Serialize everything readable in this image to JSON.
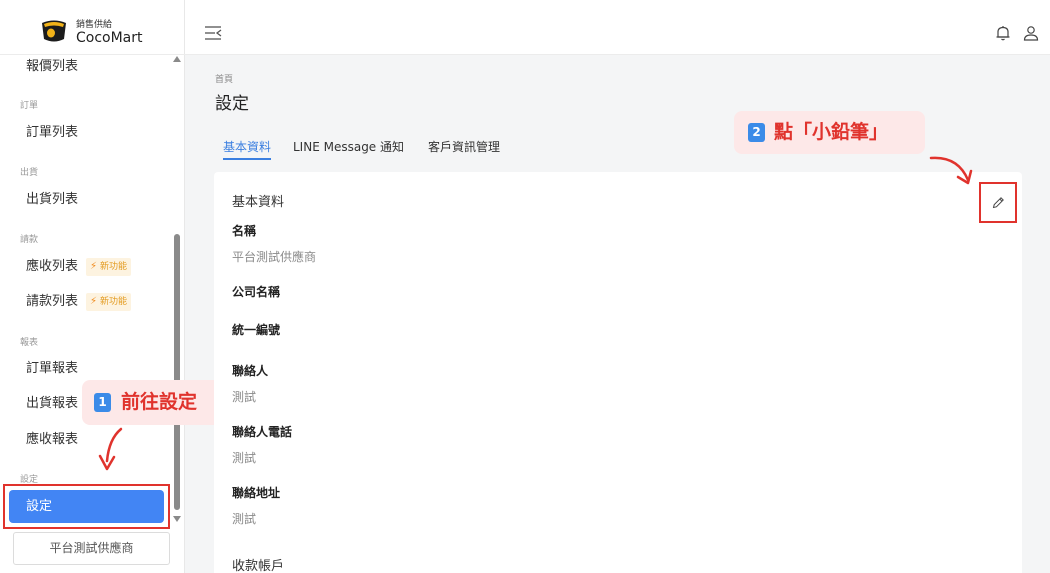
{
  "logo": {
    "subtitle": "銷售供給",
    "name": "CocoMart"
  },
  "sidebar": {
    "items": [
      {
        "label": "報價列表"
      },
      {
        "group": "訂單"
      },
      {
        "label": "訂單列表"
      },
      {
        "group": "出貨"
      },
      {
        "label": "出貨列表"
      },
      {
        "group": "請款"
      },
      {
        "label": "應收列表",
        "badge": "新功能"
      },
      {
        "label": "請款列表",
        "badge": "新功能"
      },
      {
        "group": "報表"
      },
      {
        "label": "訂單報表"
      },
      {
        "label": "出貨報表"
      },
      {
        "label": "應收報表"
      },
      {
        "group": "設定"
      },
      {
        "label": "設定",
        "active": true
      }
    ],
    "badge_icon": "⚡",
    "supplier_button": "平台測試供應商"
  },
  "annotations": {
    "step1": {
      "number": "1",
      "text": "前往設定"
    },
    "step2": {
      "number": "2",
      "text": "點「小鉛筆」"
    },
    "accent_color": "#e0332d",
    "number_color": "#3b8be8"
  },
  "breadcrumb": "首頁",
  "page_title": "設定",
  "tabs": [
    {
      "label": "基本資料",
      "active": true
    },
    {
      "label": "LINE Message 通知"
    },
    {
      "label": "客戶資訊管理"
    }
  ],
  "card": {
    "heading": "基本資料",
    "fields": [
      {
        "label": "名稱",
        "value": "平台測試供應商"
      },
      {
        "label": "公司名稱",
        "value": ""
      },
      {
        "label": "統一編號",
        "value": ""
      },
      {
        "label": "聯絡人",
        "value": "測試"
      },
      {
        "label": "聯絡人電話",
        "value": "測試"
      },
      {
        "label": "聯絡地址",
        "value": "測試"
      }
    ],
    "next_section": "收款帳戶"
  },
  "icons": {
    "menu": "menu-fold-icon",
    "bell": "bell-icon",
    "user": "user-icon",
    "edit": "pencil-icon"
  },
  "colors": {
    "primary": "#4285f4",
    "tab_active": "#3b7fe0",
    "badge": "#e39a1e"
  }
}
